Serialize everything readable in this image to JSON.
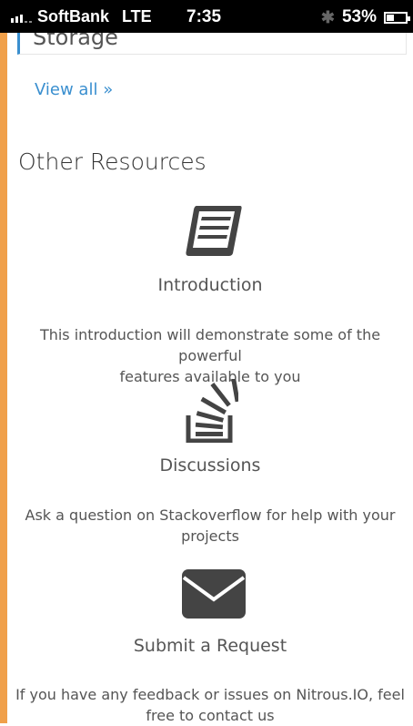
{
  "status_bar": {
    "carrier": "SoftBank",
    "network": "LTE",
    "time": "7:35",
    "battery": "53%"
  },
  "storage_card": {
    "title": "Storage"
  },
  "view_all": "View all »",
  "section_title": "Other Resources",
  "resources": [
    {
      "icon": "book-icon",
      "title": "Introduction",
      "description_line1": "This introduction will demonstrate some of the powerful",
      "description_line2": "features available to you"
    },
    {
      "icon": "stackoverflow-icon",
      "title": "Discussions",
      "description_line1": "Ask a question on Stackoverflow for help with your",
      "description_line2": "projects"
    },
    {
      "icon": "envelope-icon",
      "title": "Submit a Request",
      "description_line1": "If you have any feedback or issues on Nitrous.IO, feel",
      "description_line2": "free to contact us"
    }
  ]
}
